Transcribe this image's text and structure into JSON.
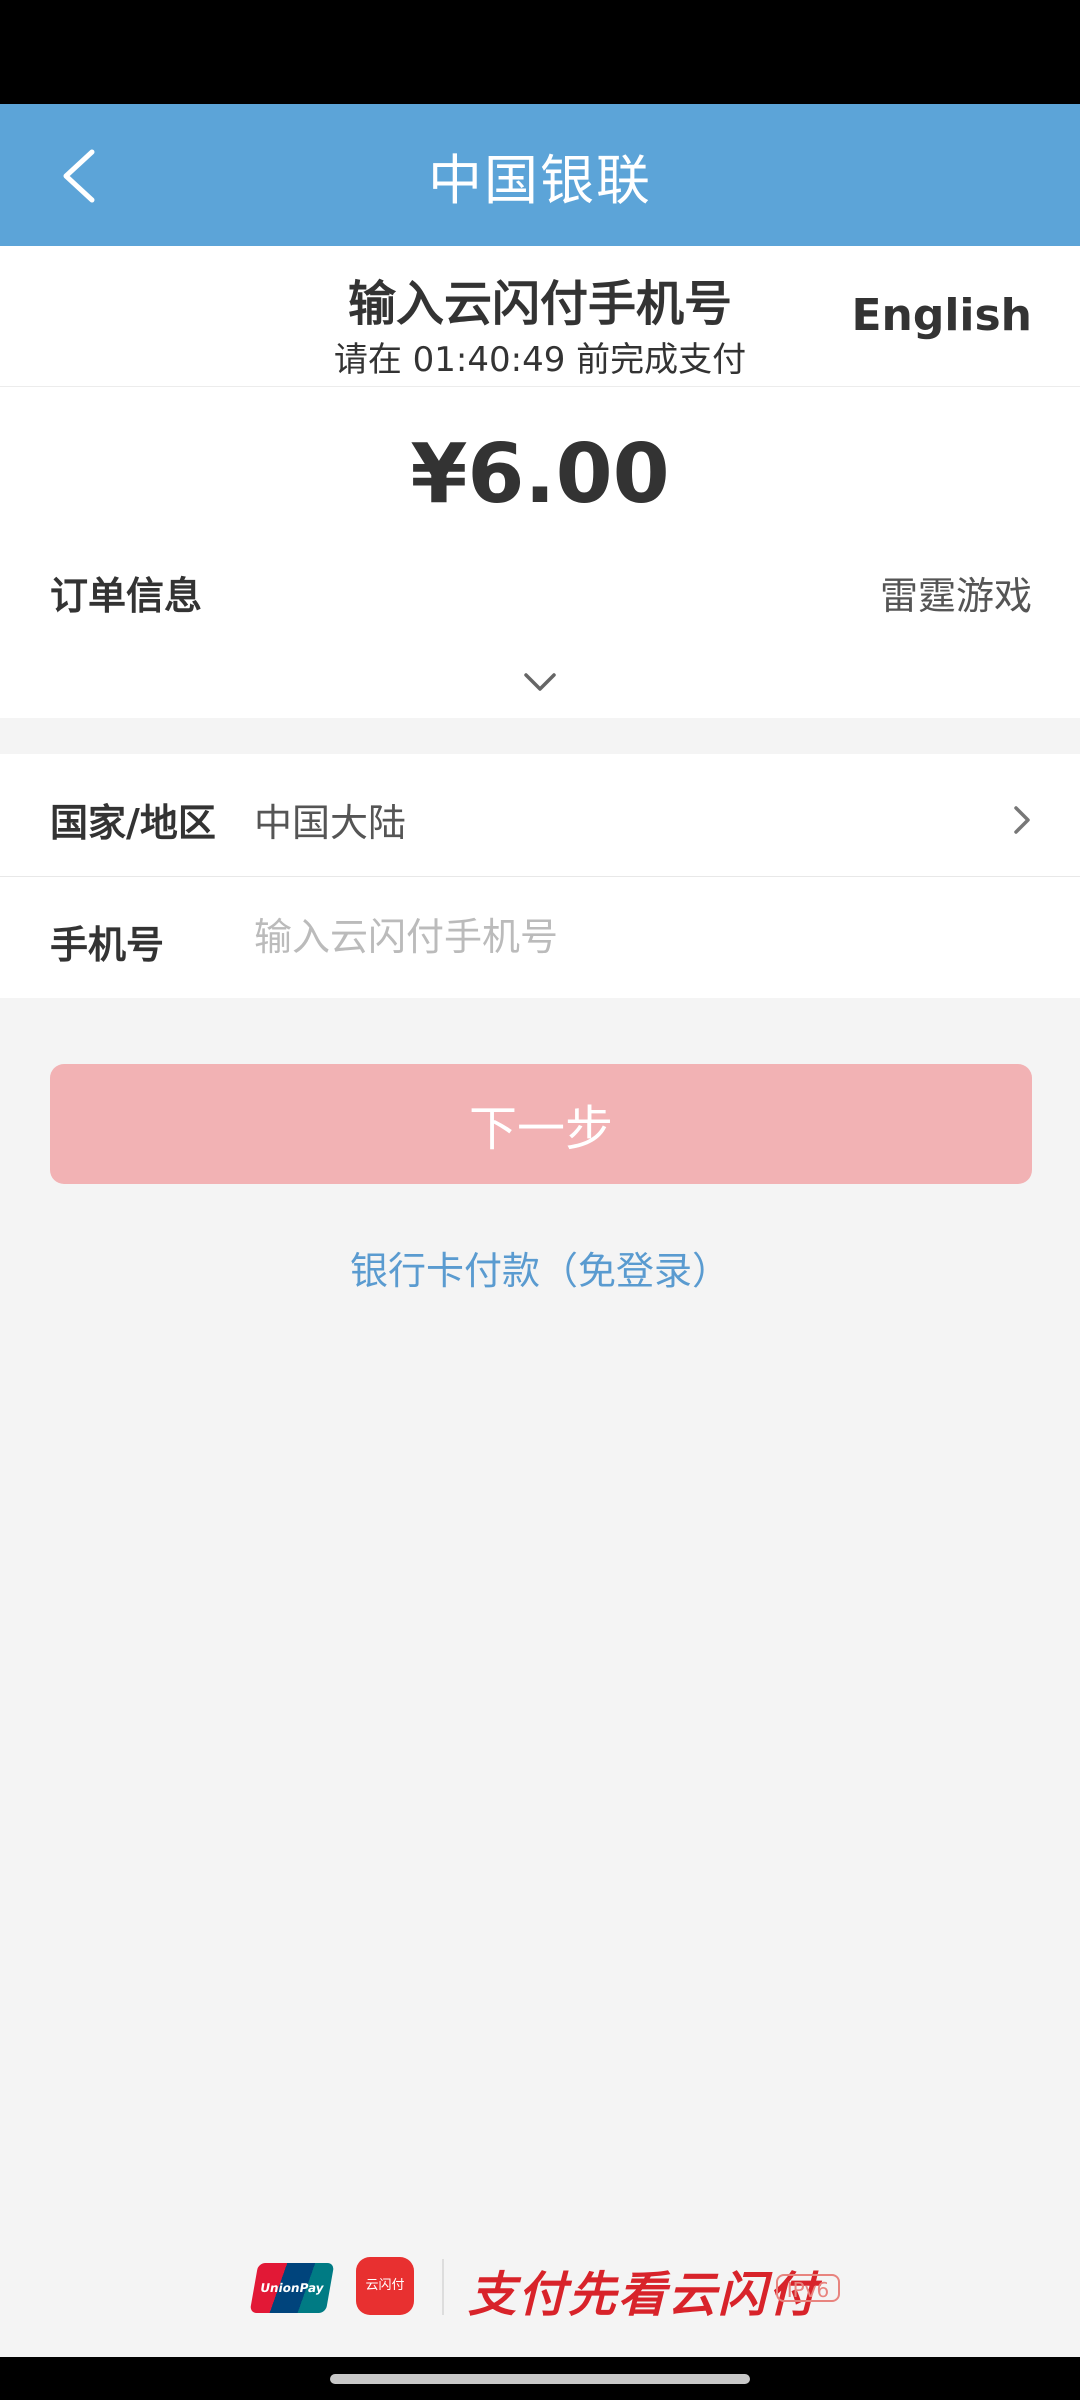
{
  "nav": {
    "title": "中国银联",
    "back_icon": "chevron-left-icon"
  },
  "header": {
    "title": "输入云闪付手机号",
    "subtitle": "请在 01:40:49 前完成支付",
    "language": "English"
  },
  "order": {
    "amount": "¥6.00",
    "label": "订单信息",
    "merchant": "雷霆游戏",
    "expand_icon": "chevron-down-icon"
  },
  "form": {
    "country_label": "国家/地区",
    "country_value": "中国大陆",
    "phone_label": "手机号",
    "phone_placeholder": "输入云闪付手机号",
    "phone_value": ""
  },
  "actions": {
    "next_label": "下一步",
    "bank_card_link": "银行卡付款（免登录）"
  },
  "footer": {
    "slogan": "支付先看云闪付",
    "ipv6": "IPv6",
    "unionpay_logo_text": "UnionPay 银联",
    "cloudpay_icon_text": "云闪付"
  },
  "colors": {
    "nav_bg": "#5ca4d8",
    "button_disabled": "#f2b2b4",
    "link": "#5a9bd0",
    "brand_red": "#d8232a"
  }
}
